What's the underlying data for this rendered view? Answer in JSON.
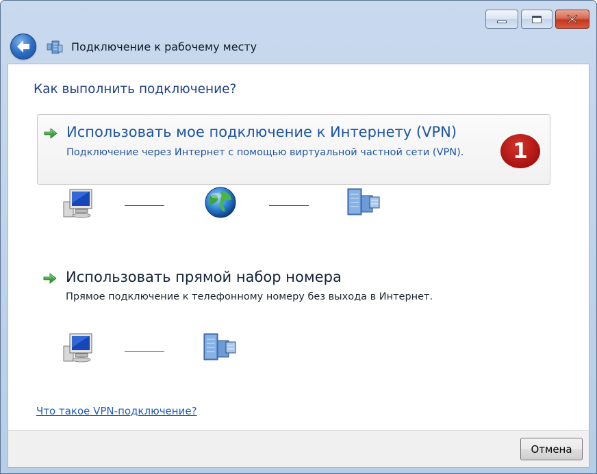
{
  "window": {
    "title": "Подключение к рабочему месту"
  },
  "main": {
    "heading": "Как выполнить подключение?",
    "options": [
      {
        "title": "Использовать мое подключение к Интернету (VPN)",
        "description": "Подключение через Интернет с помощью виртуальной частной сети (VPN).",
        "badge": "1",
        "diagram": [
          "computer-icon",
          "globe-icon",
          "server-icon"
        ]
      },
      {
        "title": "Использовать прямой набор номера",
        "description": "Прямое подключение к телефонному номеру без выхода в Интернет.",
        "diagram": [
          "computer-icon",
          "server-icon"
        ]
      }
    ],
    "help_link": "Что такое VPN-подключение?"
  },
  "footer": {
    "cancel_label": "Отмена"
  },
  "colors": {
    "heading": "#1e3f8a",
    "link": "#1e5eb8",
    "badge": "#a9120f",
    "titlebar": "#c9d9ee"
  }
}
